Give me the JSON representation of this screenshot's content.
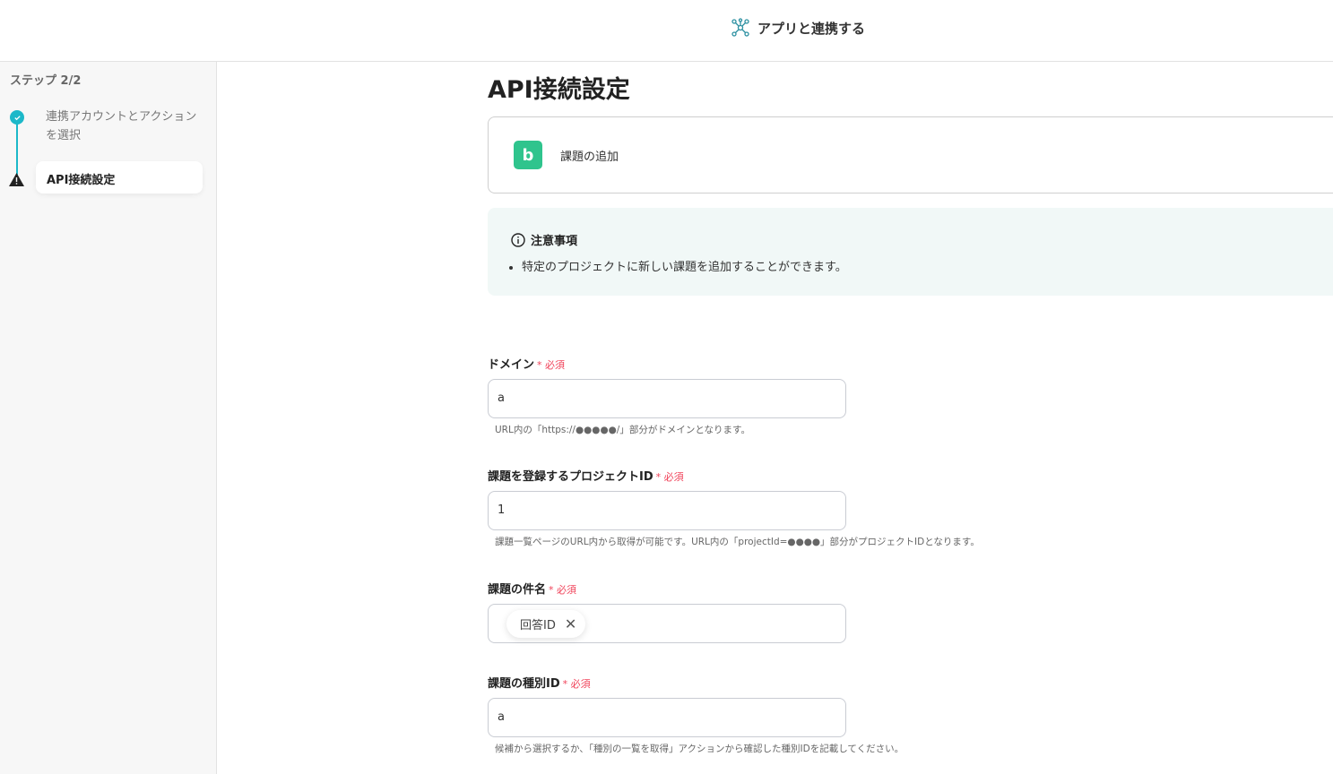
{
  "header": {
    "title": "アプリと連携する",
    "icon": "network-icon"
  },
  "sidebar": {
    "step": "ステップ 2/2",
    "steps": [
      {
        "label": "連携アカウントとアクションを選択",
        "status": "done"
      },
      {
        "label": "API接続設定",
        "status": "warning"
      }
    ]
  },
  "main": {
    "title": "API接続設定",
    "action": {
      "label": "課題の追加",
      "app_letter": "b",
      "app_color": "#2fc48d"
    },
    "notice": {
      "title": "注意事項",
      "items": [
        "特定のプロジェクトに新しい課題を追加することができます。"
      ]
    },
    "required_label": "必須",
    "fields": [
      {
        "label": "ドメイン",
        "value": "a",
        "help": "URL内の「https://●●●●●/」部分がドメインとなります。"
      },
      {
        "label": "課題を登録するプロジェクトID",
        "value": "1",
        "help": "課題一覧ページのURL内から取得が可能です。URL内の「projectId=●●●●」部分がプロジェクトIDとなります。"
      },
      {
        "label": "課題の件名",
        "chip": "回答ID"
      },
      {
        "label": "課題の種別ID",
        "value": "a",
        "help": "候補から選択するか、「種別の一覧を取得」アクションから確認した種別IDを記載してください。"
      }
    ]
  }
}
